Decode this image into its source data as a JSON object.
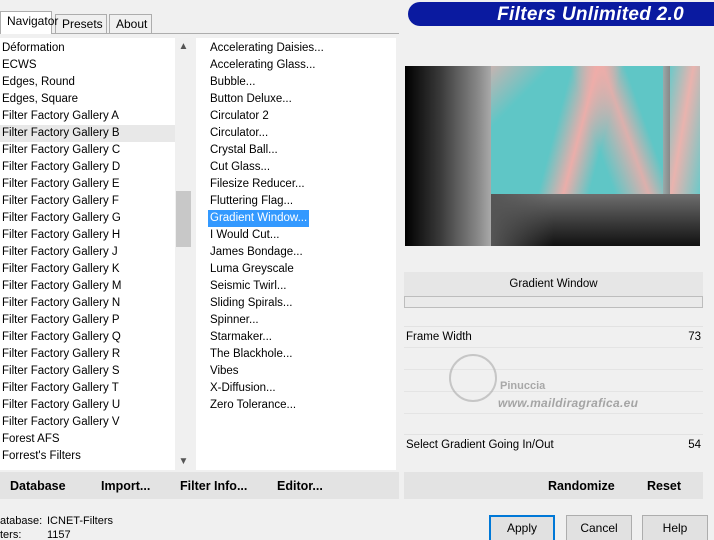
{
  "tabs": [
    {
      "label": "Navigator",
      "active": true
    },
    {
      "label": "Presets",
      "active": false
    },
    {
      "label": "About",
      "active": false
    }
  ],
  "title": "Filters Unlimited 2.0",
  "categories": [
    "Déformation",
    "ECWS",
    "Edges, Round",
    "Edges, Square",
    "Filter Factory Gallery A",
    "Filter Factory Gallery B",
    "Filter Factory Gallery C",
    "Filter Factory Gallery D",
    "Filter Factory Gallery E",
    "Filter Factory Gallery F",
    "Filter Factory Gallery G",
    "Filter Factory Gallery H",
    "Filter Factory Gallery J",
    "Filter Factory Gallery K",
    "Filter Factory Gallery M",
    "Filter Factory Gallery N",
    "Filter Factory Gallery P",
    "Filter Factory Gallery Q",
    "Filter Factory Gallery R",
    "Filter Factory Gallery S",
    "Filter Factory Gallery T",
    "Filter Factory Gallery U",
    "Filter Factory Gallery V",
    "Forest AFS",
    "Forrest's Filters"
  ],
  "selected_category": "Filter Factory Gallery B",
  "filters": [
    "Accelerating Daisies...",
    "Accelerating Glass...",
    "Bubble...",
    "Button Deluxe...",
    "Circulator 2",
    "Circulator...",
    "Crystal Ball...",
    "Cut Glass...",
    "Filesize Reducer...",
    "Fluttering Flag...",
    "Gradient Window...",
    "I Would Cut...",
    "James Bondage...",
    "Luma Greyscale",
    "Seismic Twirl...",
    "Sliding Spirals...",
    "Spinner...",
    "Starmaker...",
    "The Blackhole...",
    "Vibes",
    "X-Diffusion...",
    "Zero Tolerance..."
  ],
  "selected_filter": "Gradient Window...",
  "preview": {
    "name": "Gradient Window"
  },
  "parameters": [
    {
      "label": "Frame Width",
      "value": "73"
    },
    {
      "label": "Select Gradient Going In/Out",
      "value": "54"
    }
  ],
  "watermark": {
    "name": "Pinuccia",
    "url": "www.maildiragrafica.eu"
  },
  "toolbar": {
    "database": "Database",
    "import": "Import...",
    "filter_info": "Filter Info...",
    "editor": "Editor...",
    "randomize": "Randomize",
    "reset": "Reset"
  },
  "status": {
    "database_label": "atabase:",
    "database_value": "ICNET-Filters",
    "filters_label": "ters:",
    "filters_value": "1157"
  },
  "buttons": {
    "apply": "Apply",
    "cancel": "Cancel",
    "help": "Help"
  },
  "colors": {
    "banner": "#0a1aa0",
    "selection": "#3399ff",
    "apply_border": "#0078d7"
  }
}
